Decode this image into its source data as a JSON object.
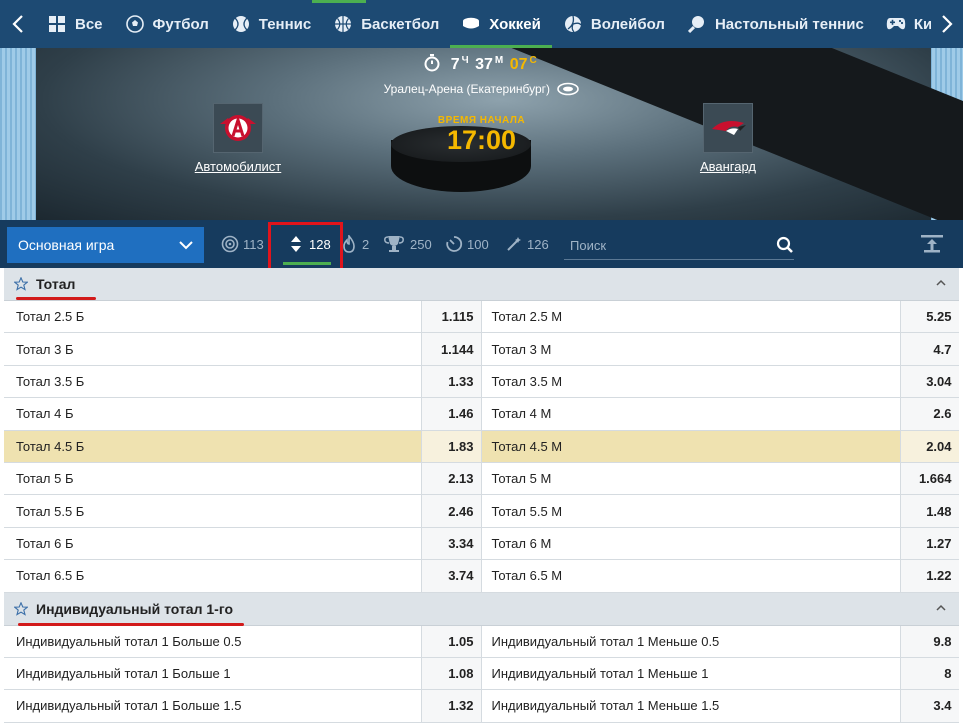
{
  "nav": {
    "items": [
      {
        "label": "Все",
        "icon": "grid-icon"
      },
      {
        "label": "Футбол",
        "icon": "soccer-ball-icon"
      },
      {
        "label": "Теннис",
        "icon": "tennis-ball-icon"
      },
      {
        "label": "Баскетбол",
        "icon": "basketball-icon"
      },
      {
        "label": "Хоккей",
        "icon": "hockey-puck-icon",
        "active": true
      },
      {
        "label": "Волейбол",
        "icon": "volleyball-icon"
      },
      {
        "label": "Настольный теннис",
        "icon": "table-tennis-icon"
      },
      {
        "label": "КиберСпорт",
        "icon": "gamepad-icon"
      }
    ]
  },
  "match": {
    "timer": {
      "hours": "7",
      "h_unit": "Ч",
      "minutes": "37",
      "m_unit": "М",
      "seconds": "07",
      "s_unit": "С"
    },
    "venue": "Уралец-Арена (Екатеринбург)",
    "home_team": "Автомобилист",
    "away_team": "Авангард",
    "start_label": "ВРЕМЯ НАЧАЛА",
    "start_time": "17:00"
  },
  "toolbar": {
    "select_value": "Основная игра",
    "tools": [
      {
        "icon": "target-icon",
        "count": "113"
      },
      {
        "icon": "up-down-arrows-icon",
        "count": "128",
        "active": true
      },
      {
        "icon": "flame-icon",
        "count": "2"
      },
      {
        "icon": "trophy-icon",
        "count": "250"
      },
      {
        "icon": "stopwatch-icon",
        "count": "100"
      },
      {
        "icon": "magic-wand-icon",
        "count": "126"
      }
    ],
    "search_placeholder": "Поиск"
  },
  "sections": [
    {
      "title": "Тотал",
      "rows": [
        {
          "left": "Тотал 2.5 Б",
          "left_odd": "1.115",
          "right": "Тотал 2.5 М",
          "right_odd": "5.25"
        },
        {
          "left": "Тотал 3 Б",
          "left_odd": "1.144",
          "right": "Тотал 3 М",
          "right_odd": "4.7"
        },
        {
          "left": "Тотал 3.5 Б",
          "left_odd": "1.33",
          "right": "Тотал 3.5 М",
          "right_odd": "3.04"
        },
        {
          "left": "Тотал 4 Б",
          "left_odd": "1.46",
          "right": "Тотал 4 М",
          "right_odd": "2.6"
        },
        {
          "left": "Тотал 4.5 Б",
          "left_odd": "1.83",
          "right": "Тотал 4.5 М",
          "right_odd": "2.04",
          "highlighted": true
        },
        {
          "left": "Тотал 5 Б",
          "left_odd": "2.13",
          "right": "Тотал 5 М",
          "right_odd": "1.664"
        },
        {
          "left": "Тотал 5.5 Б",
          "left_odd": "2.46",
          "right": "Тотал 5.5 М",
          "right_odd": "1.48"
        },
        {
          "left": "Тотал 6 Б",
          "left_odd": "3.34",
          "right": "Тотал 6 М",
          "right_odd": "1.27"
        },
        {
          "left": "Тотал 6.5 Б",
          "left_odd": "3.74",
          "right": "Тотал 6.5 М",
          "right_odd": "1.22"
        }
      ]
    },
    {
      "title": "Индивидуальный тотал 1-го",
      "rows": [
        {
          "left": "Индивидуальный тотал 1 Больше 0.5",
          "left_odd": "1.05",
          "right": "Индивидуальный тотал 1 Меньше 0.5",
          "right_odd": "9.8"
        },
        {
          "left": "Индивидуальный тотал 1 Больше 1",
          "left_odd": "1.08",
          "right": "Индивидуальный тотал 1 Меньше 1",
          "right_odd": "8"
        },
        {
          "left": "Индивидуальный тотал 1 Больше 1.5",
          "left_odd": "1.32",
          "right": "Индивидуальный тотал 1 Меньше 1.5",
          "right_odd": "3.4"
        }
      ]
    }
  ],
  "colors": {
    "nav_bg": "#1d4a73",
    "toolbar_bg": "#163b5e",
    "accent_green": "#4caf50",
    "gold": "#f5b800",
    "select_blue": "#1f6fc0",
    "highlight_row": "#efe2b0",
    "annotation_red": "#e0141c"
  }
}
